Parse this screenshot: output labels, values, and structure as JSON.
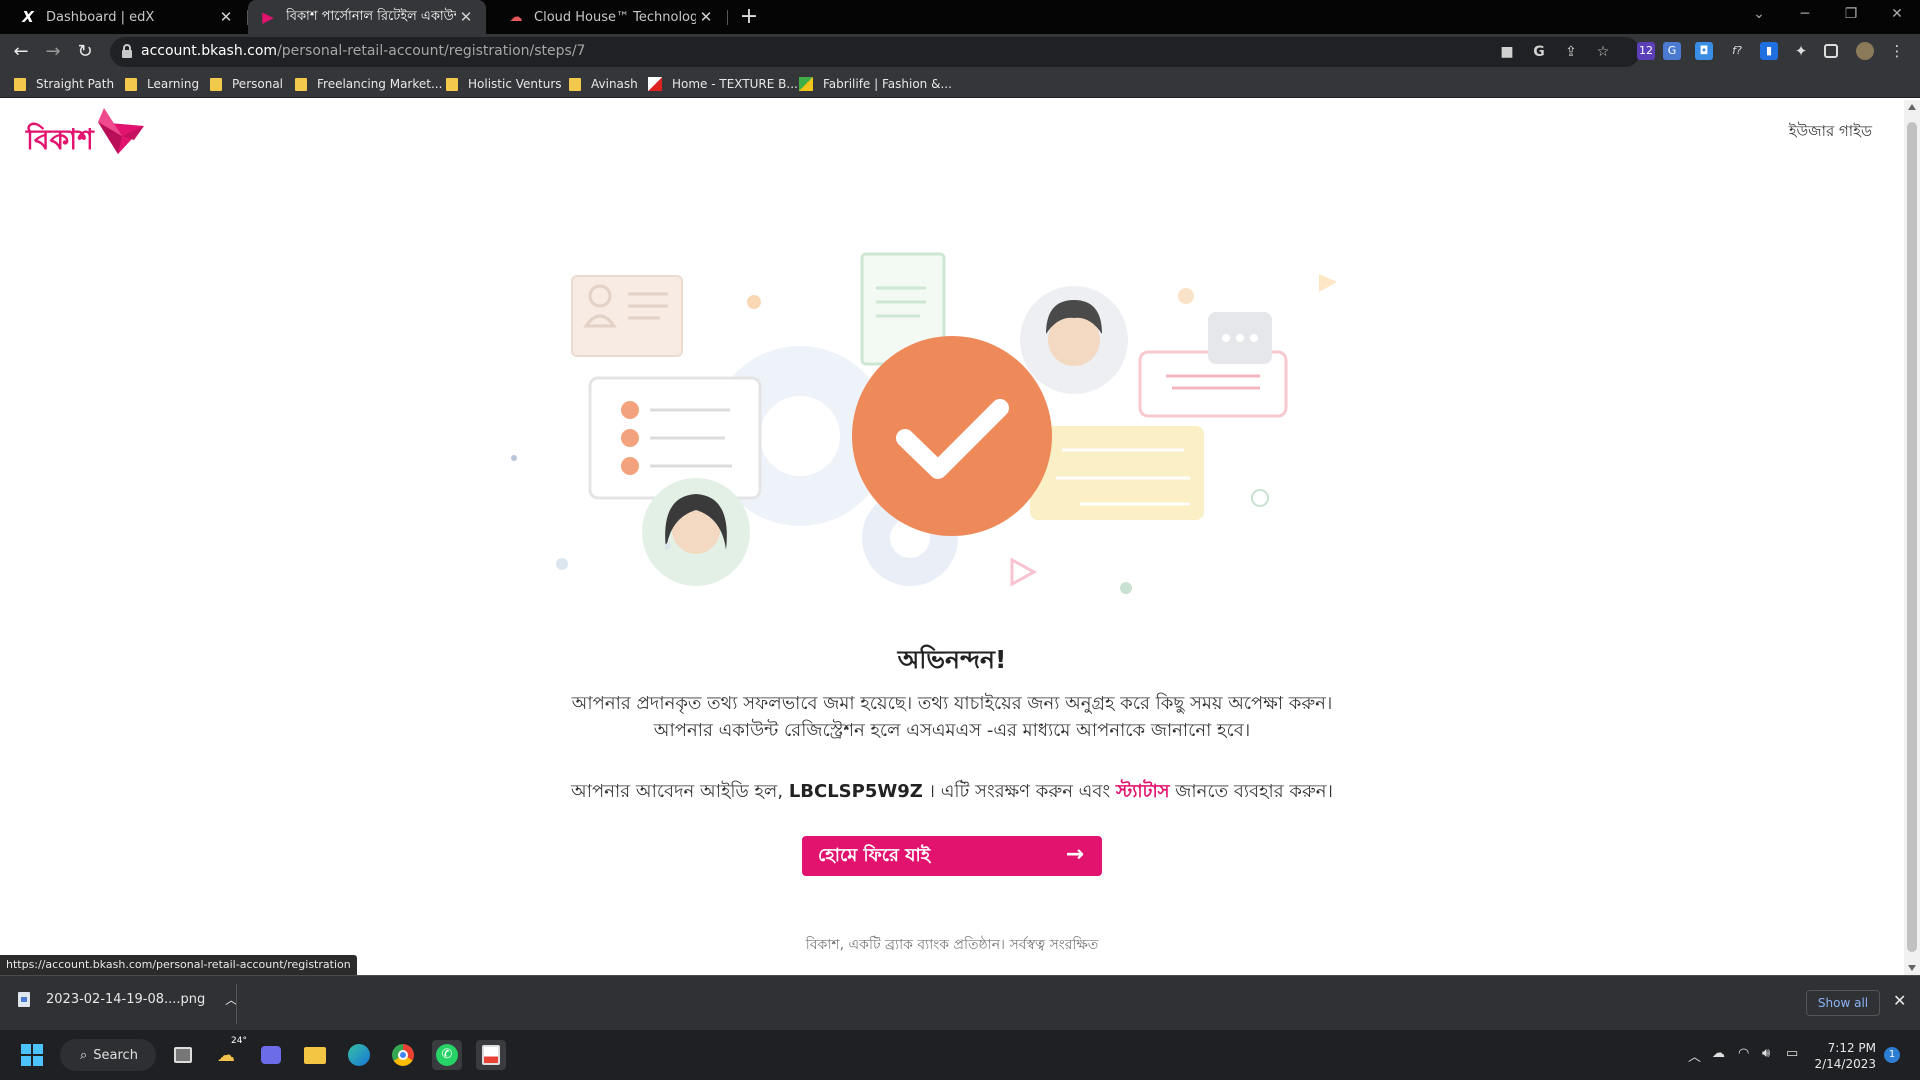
{
  "tabs": [
    {
      "title": "Dashboard | edX",
      "favicon": "X"
    },
    {
      "title": "বিকাশ পার্সোনাল রিটেইল একাউন্ট",
      "favicon": "▶"
    },
    {
      "title": "Cloud House™ Technologies Ban",
      "favicon": "☁"
    }
  ],
  "address_bar": {
    "host": "account.bkash.com",
    "path": "/personal-retail-account/registration/steps/7"
  },
  "bookmarks": [
    "Straight Path",
    "Learning",
    "Personal",
    "Freelancing Market...",
    "Holistic Venturs",
    "Avinash",
    "Home - TEXTURE B...",
    "Fabrilife | Fashion &..."
  ],
  "extension_badge": "12",
  "page": {
    "logo_text": "বিকাশ",
    "user_guide": "ইউজার গাইড",
    "congrats_title": "অভিনন্দন!",
    "message": "আপনার প্রদানকৃত তথ্য সফলভাবে জমা হয়েছে। তথ্য যাচাইয়ের জন্য অনুগ্রহ করে কিছু সময় অপেক্ষা করুন। আপনার একাউন্ট রেজিস্ট্রেশন হলে এসএমএস -এর মাধ্যমে আপনাকে জানানো হবে।",
    "appid_prefix": "আপনার আবেদন আইডি হল,",
    "application_id": "LBCLSP5W9Z",
    "appid_middle": "। এটি সংরক্ষণ করুন এবং",
    "status_link": "স্ট্যাটাস",
    "appid_suffix": "জানতে ব্যবহার করুন।",
    "home_button": "হোমে ফিরে যাই",
    "footer": "বিকাশ, একটি ব্র্যাক ব্যাংক প্রতিষ্ঠান। সর্বস্বত্ব সংরক্ষিত"
  },
  "status_url": "https://account.bkash.com/personal-retail-account/registration",
  "download": {
    "filename": "2023-02-14-19-08....png",
    "show_all": "Show all"
  },
  "taskbar": {
    "search": "Search",
    "weather": "24°",
    "time": "7:12 PM",
    "date": "2/14/2023",
    "notifications": "1"
  },
  "colors": {
    "brand": "#e2136e",
    "check": "#ee8a5a"
  }
}
